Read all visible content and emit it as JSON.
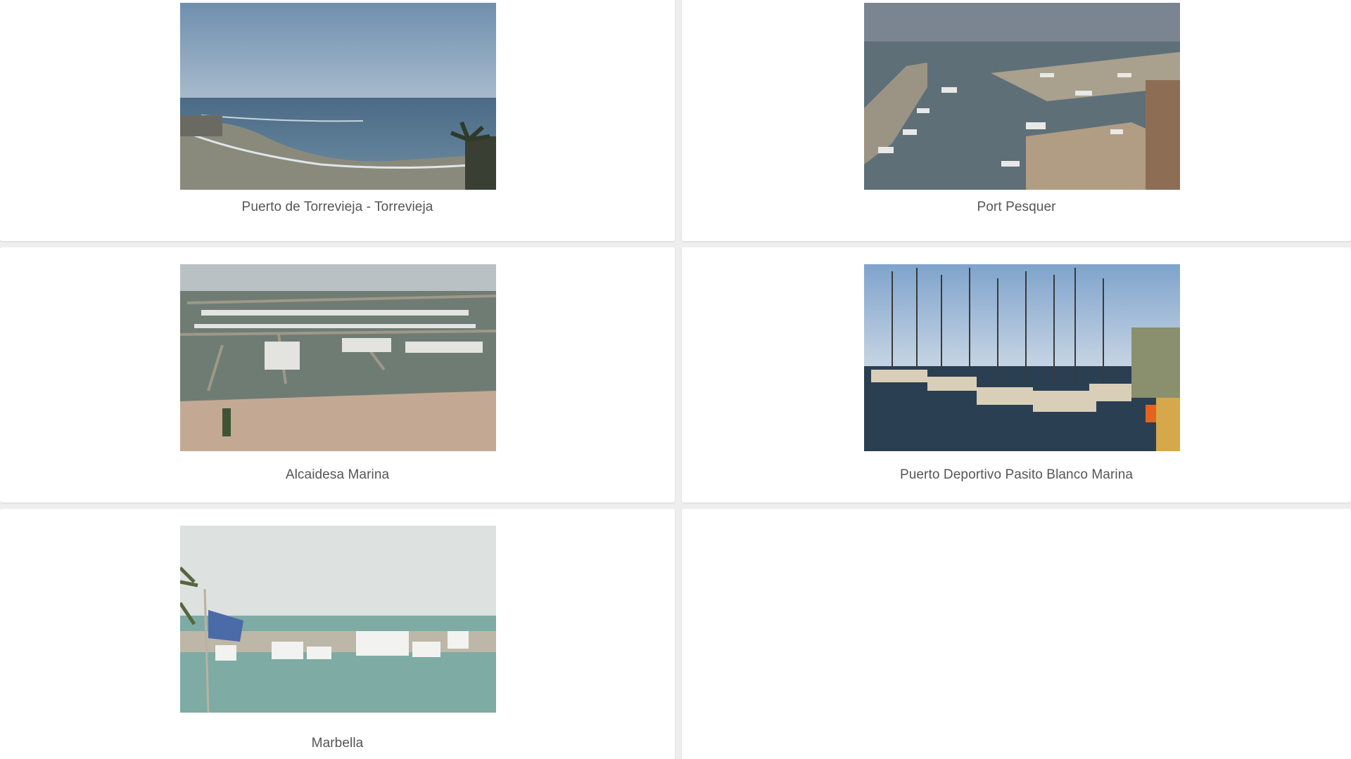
{
  "webcams": [
    {
      "title": "Puerto de Torrevieja - Torrevieja",
      "thumbnail": "beach-sea-webcam-image"
    },
    {
      "title": "Port Pesquer",
      "thumbnail": "fishing-port-webcam-image"
    },
    {
      "title": "Alcaidesa Marina",
      "thumbnail": "marina-aerial-webcam-image"
    },
    {
      "title": "Puerto Deportivo Pasito Blanco Marina",
      "thumbnail": "sailboats-marina-webcam-image"
    },
    {
      "title": "Marbella",
      "thumbnail": "marbella-harbor-webcam-image"
    }
  ],
  "colors": {
    "background": "#eeeeee",
    "card": "#ffffff",
    "caption_text": "#555555"
  }
}
